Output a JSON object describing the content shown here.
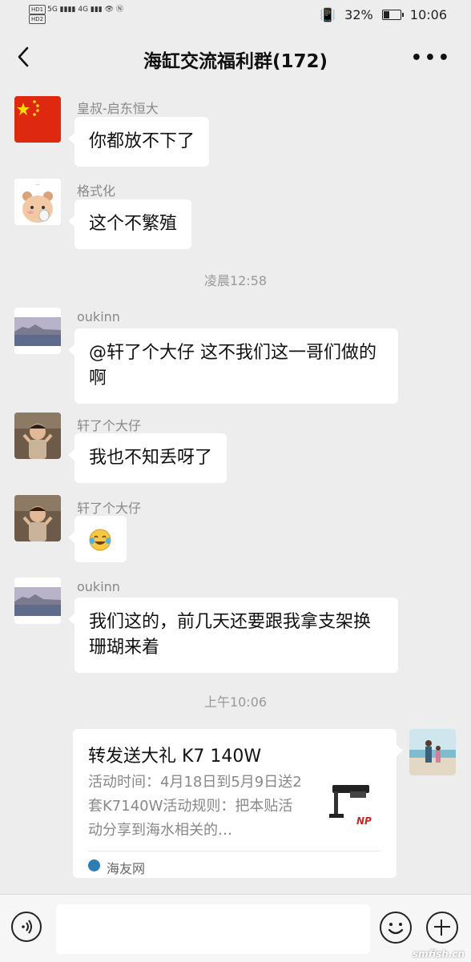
{
  "status_bar": {
    "left_text": "HD 5G 4G",
    "battery": "32%",
    "time": "10:06"
  },
  "header": {
    "title": "海缸交流福利群(172)",
    "back_icon": "chevron-left-icon",
    "more_label": "•••"
  },
  "messages": [
    {
      "sender": "皇叔-启东恒大",
      "text": "你都放不下了",
      "avatar": "china-flag"
    },
    {
      "sender": "格式化",
      "text": "这个不繁殖",
      "avatar": "cartoon-bear-sticker"
    },
    {
      "sender": "oukinn",
      "text": "@轩了个大仔  这不我们这一哥们做的啊",
      "avatar": "landscape-photo"
    },
    {
      "sender": "轩了个大仔",
      "text": "我也不知丢呀了",
      "avatar": "child-photo"
    },
    {
      "sender": "轩了个大仔",
      "text": "",
      "avatar": "child-photo",
      "emoji": "laughing-crying-emoji"
    },
    {
      "sender": "oukinn",
      "text": "我们这的，前几天还要跟我拿支架换珊瑚来着",
      "avatar": "landscape-photo"
    }
  ],
  "timestamps": {
    "t1": "凌晨12:58",
    "t2": "上午10:06"
  },
  "share_card": {
    "title": "转发送大礼 K7 140W",
    "description": "活动时间：4月18日到5月9日送2套K7140W活动规则：把本贴活动分享到海水相关的…",
    "source": "海友网",
    "thumb_text": "NP"
  },
  "input_bar": {
    "placeholder": ""
  },
  "watermark": "smfish.cn",
  "colors": {
    "background": "#ededed",
    "bubble": "#ffffff",
    "flag_red": "#de2910",
    "flag_yellow": "#ffde00"
  }
}
